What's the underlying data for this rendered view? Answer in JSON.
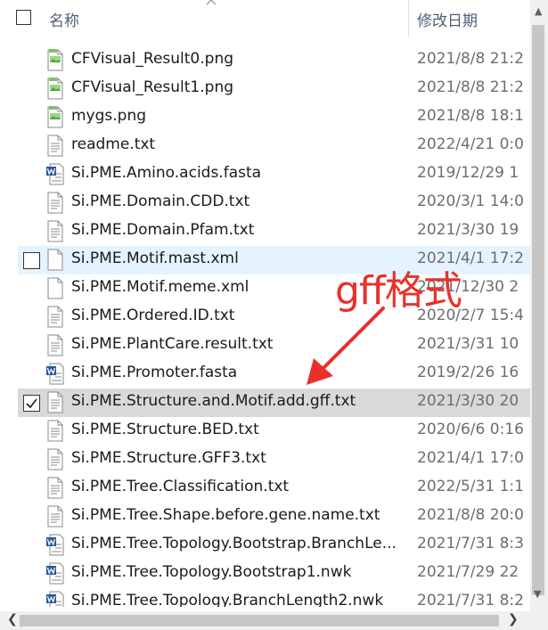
{
  "header": {
    "name_label": "名称",
    "date_label": "修改日期"
  },
  "files": [
    {
      "name": "CFVisual_Result0.png",
      "date": "2021/8/8 21:2",
      "icon": "image-file-icon"
    },
    {
      "name": "CFVisual_Result1.png",
      "date": "2021/8/8 21:2",
      "icon": "image-file-icon"
    },
    {
      "name": "mygs.png",
      "date": "2021/8/8 18:1",
      "icon": "image-file-icon"
    },
    {
      "name": "readme.txt",
      "date": "2022/4/21 0:0",
      "icon": "text-file-icon"
    },
    {
      "name": "Si.PME.Amino.acids.fasta",
      "date": "2019/12/29 1",
      "icon": "word-file-icon"
    },
    {
      "name": "Si.PME.Domain.CDD.txt",
      "date": "2020/3/1 14:0",
      "icon": "text-file-icon"
    },
    {
      "name": "Si.PME.Domain.Pfam.txt",
      "date": "2021/3/30 19",
      "icon": "text-file-icon"
    },
    {
      "name": "Si.PME.Motif.mast.xml",
      "date": "2021/4/1 17:2",
      "icon": "blank-file-icon"
    },
    {
      "name": "Si.PME.Motif.meme.xml",
      "date": "2021/12/30 2",
      "icon": "blank-file-icon"
    },
    {
      "name": "Si.PME.Ordered.ID.txt",
      "date": "2020/2/7 15:4",
      "icon": "text-file-icon"
    },
    {
      "name": "Si.PME.PlantCare.result.txt",
      "date": "2021/3/31 10",
      "icon": "text-file-icon"
    },
    {
      "name": "Si.PME.Promoter.fasta",
      "date": "2019/2/26 16",
      "icon": "word-file-icon"
    },
    {
      "name": "Si.PME.Structure.and.Motif.add.gff.txt",
      "date": "2021/3/30 20",
      "icon": "text-file-icon"
    },
    {
      "name": "Si.PME.Structure.BED.txt",
      "date": "2020/6/6 0:16",
      "icon": "text-file-icon"
    },
    {
      "name": "Si.PME.Structure.GFF3.txt",
      "date": "2021/4/1 17:0",
      "icon": "text-file-icon"
    },
    {
      "name": "Si.PME.Tree.Classification.txt",
      "date": "2022/5/31 1:1",
      "icon": "text-file-icon"
    },
    {
      "name": "Si.PME.Tree.Shape.before.gene.name.txt",
      "date": "2021/8/8 20:0",
      "icon": "text-file-icon"
    },
    {
      "name": "Si.PME.Tree.Topology.Bootstrap.BranchLe...",
      "date": "2021/7/31 8:3",
      "icon": "word-file-icon"
    },
    {
      "name": "Si.PME.Tree.Topology.Bootstrap1.nwk",
      "date": "2021/7/29 22",
      "icon": "word-file-icon"
    },
    {
      "name": "Si.PME.Tree.Topology.BranchLength2.nwk",
      "date": "2021/7/31 8:2",
      "icon": "word-file-icon"
    }
  ],
  "hovered_index": 7,
  "selected_index": 12,
  "annotation": {
    "text": "gff格式",
    "color": "#e8312a"
  },
  "colors": {
    "hover_bg": "#e5f3ff",
    "selected_bg": "#d9d9d9",
    "header_text": "#4c607a"
  }
}
